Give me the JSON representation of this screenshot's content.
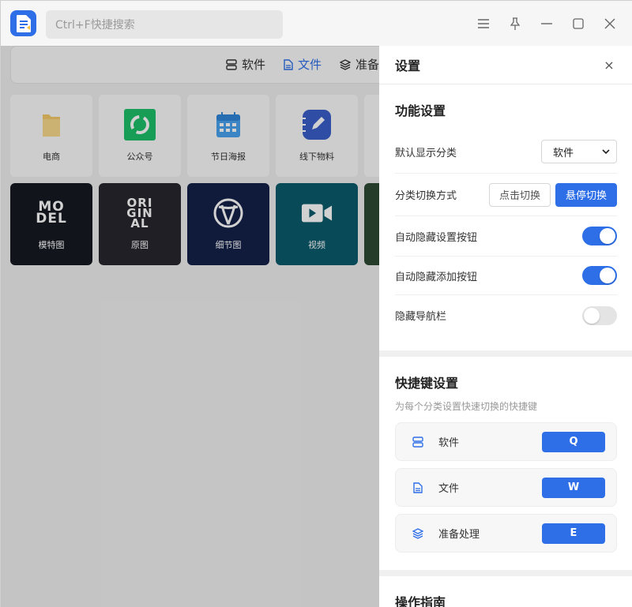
{
  "search": {
    "placeholder": "Ctrl+F快捷搜索"
  },
  "nav": {
    "items": [
      "软件",
      "文件",
      "准备"
    ]
  },
  "tiles": [
    {
      "label": "电商",
      "icon": "folder-icon"
    },
    {
      "label": "公众号",
      "icon": "wechat-channel-icon"
    },
    {
      "label": "节日海报",
      "icon": "calendar-icon"
    },
    {
      "label": "线下物料",
      "icon": "notebook-pen-icon"
    },
    {
      "label": "模特图",
      "icon": "model-text-icon",
      "art": [
        "MO",
        "DEL"
      ],
      "color": "#151a22"
    },
    {
      "label": "原图",
      "icon": "original-text-icon",
      "art": [
        "ORI",
        "GIN",
        "AL"
      ],
      "color": "#26272e"
    },
    {
      "label": "细节图",
      "icon": "detail-emblem-icon",
      "color": "#14224a"
    },
    {
      "label": "视频",
      "icon": "video-camera-icon",
      "color": "#0b5b6d"
    }
  ],
  "panel": {
    "title": "设置",
    "close_symbol": "×",
    "func": {
      "title": "功能设置",
      "default_label": "默认显示分类",
      "default_value": "软件",
      "switch_label": "分类切换方式",
      "switch_click": "点击切换",
      "switch_hover": "悬停切换",
      "auto_hide_settings": "自动隐藏设置按钮",
      "auto_hide_settings_on": true,
      "auto_hide_add": "自动隐藏添加按钮",
      "auto_hide_add_on": true,
      "hide_nav": "隐藏导航栏",
      "hide_nav_on": false
    },
    "shortcuts": {
      "title": "快捷键设置",
      "hint": "为每个分类设置快速切换的快捷键",
      "items": [
        {
          "label": "软件",
          "key": "Q",
          "icon": "server-icon"
        },
        {
          "label": "文件",
          "key": "W",
          "icon": "file-icon"
        },
        {
          "label": "准备处理",
          "key": "E",
          "icon": "layers-icon"
        }
      ]
    },
    "guide": {
      "title": "操作指南"
    }
  },
  "colors": {
    "accent": "#2e6fe8"
  }
}
